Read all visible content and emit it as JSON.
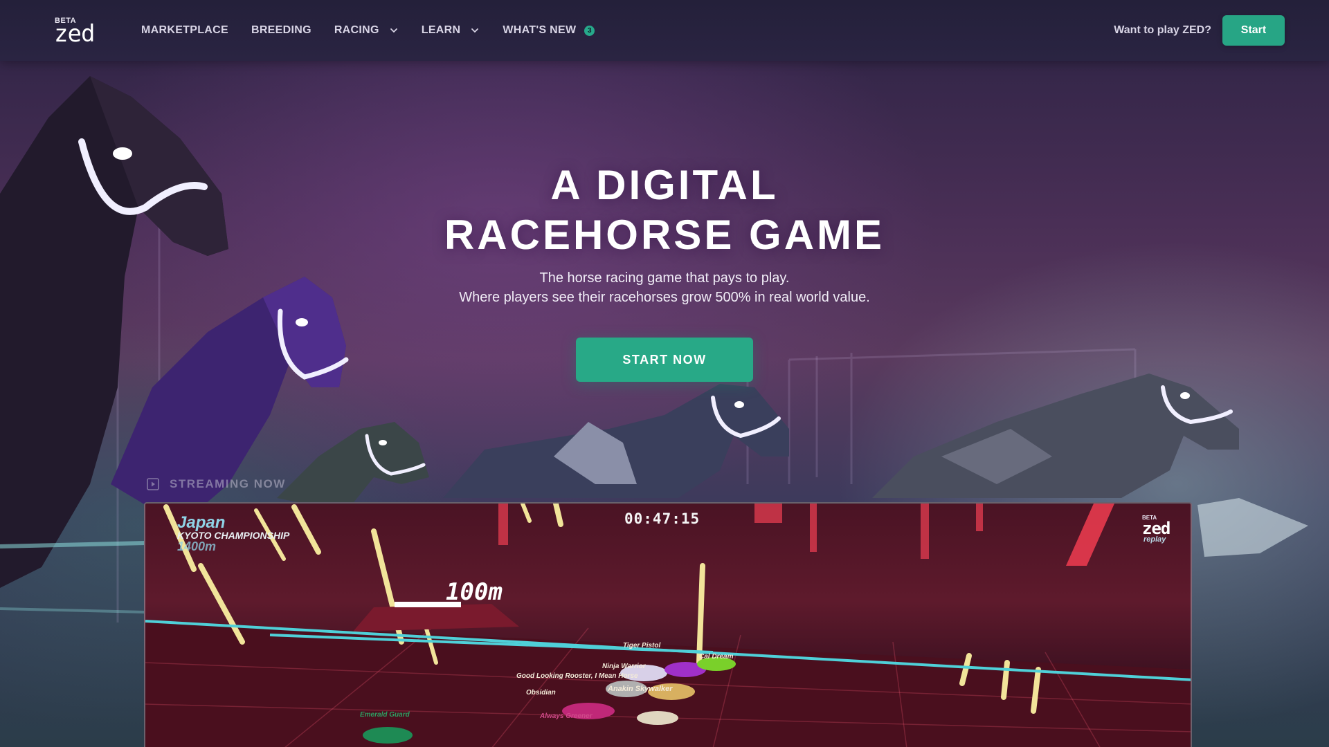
{
  "header": {
    "logo": {
      "beta": "BETA",
      "mark": "zed"
    },
    "nav": [
      {
        "label": "MARKETPLACE"
      },
      {
        "label": "BREEDING"
      },
      {
        "label": "RACING"
      },
      {
        "label": "LEARN"
      },
      {
        "label": "WHAT'S NEW",
        "badge": "3"
      }
    ],
    "cta_text": "Want to play ZED?",
    "start_label": "Start"
  },
  "hero": {
    "title_line1": "A DIGITAL",
    "title_line2": "RACEHORSE GAME",
    "subtitle_line1": "The horse racing game that pays to play.",
    "subtitle_line2": "Where players see their racehorses grow 500% in real world value.",
    "button_label": "START NOW"
  },
  "streaming": {
    "label": "STREAMING NOW",
    "overlay": {
      "country": "Japan",
      "event": "KYOTO CHAMPIONSHIP",
      "distance": "1400m",
      "timer": "00:47:15",
      "marker": "100m",
      "logo_beta": "BETA",
      "logo": "zed",
      "logo_sub": "replay",
      "horses": [
        "Tiger Pistol",
        "Ninja Warrior",
        "Cal Dream",
        "Good Looking Rooster, I Mean Horse",
        "Anakin Skywalker",
        "Obsidian",
        "Emerald Guard",
        "Always Greener"
      ]
    }
  },
  "colors": {
    "accent": "#27a585",
    "header_bg": "#24203a",
    "nav_text": "#d9d5e6",
    "video_bg": "#4a1324"
  },
  "icons": {
    "chevron": "chevron-down-icon",
    "play": "play-square-icon"
  }
}
